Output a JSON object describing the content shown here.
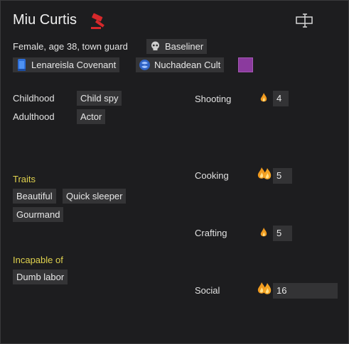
{
  "pawn": {
    "name": "Miu Curtis",
    "description": "Female, age 38, town guard",
    "xenotype": "Baseliner",
    "faction": "Lenareisla Covenant",
    "ideology": "Nuchadean Cult",
    "ideology_color": "#8b3a9e"
  },
  "backstory": {
    "childhood_label": "Childhood",
    "childhood_value": "Child spy",
    "adulthood_label": "Adulthood",
    "adulthood_value": "Actor"
  },
  "traits": {
    "header": "Traits",
    "items": [
      "Beautiful",
      "Quick sleeper",
      "Gourmand"
    ]
  },
  "incapable": {
    "header": "Incapable of",
    "items": [
      "Dumb labor"
    ]
  },
  "skills": [
    {
      "name": "Shooting",
      "level": "4",
      "passion": "minor",
      "bar": 0.2
    },
    {
      "name": "Cooking",
      "level": "5",
      "passion": "major",
      "bar": 0.25
    },
    {
      "name": "Crafting",
      "level": "5",
      "passion": "minor",
      "bar": 0.25
    },
    {
      "name": "Social",
      "level": "16",
      "passion": "major",
      "bar": 0.8
    }
  ],
  "icons": {
    "banish": "gavel-icon",
    "rename": "rename-icon",
    "xenotype": "skull-icon",
    "faction": "faction-banner-icon",
    "ideology": "ideology-icon",
    "passion_minor": "flame-icon",
    "passion_major": "double-flame-icon"
  }
}
